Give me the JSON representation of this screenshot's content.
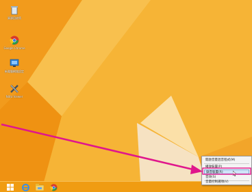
{
  "desktop_icons": [
    {
      "name": "recycle-bin-icon",
      "label": "資源回收筒"
    },
    {
      "name": "chrome-icon",
      "label": "Google Chrome"
    },
    {
      "name": "network-icon",
      "label": "新電腦網路設定"
    },
    {
      "name": "close-app-icon",
      "label": "Nitro Viewer"
    }
  ],
  "context_menu": {
    "items": [
      {
        "label": "開啟音量混音程式(M)"
      },
      {
        "label": "播放裝置(P)"
      },
      {
        "label": "錄音裝置(R)"
      },
      {
        "label": "音效(S)"
      },
      {
        "label": "音量控制選項(V)"
      }
    ]
  },
  "taskbar": {
    "buttons": [
      {
        "name": "start-button-icon"
      },
      {
        "name": "ie-icon"
      },
      {
        "name": "file-explorer-icon"
      },
      {
        "name": "chrome-taskbar-icon"
      }
    ]
  },
  "colors": {
    "wallpaper": "#f5b032",
    "arrow": "#e0168c",
    "taskbar": "#f09c12"
  }
}
